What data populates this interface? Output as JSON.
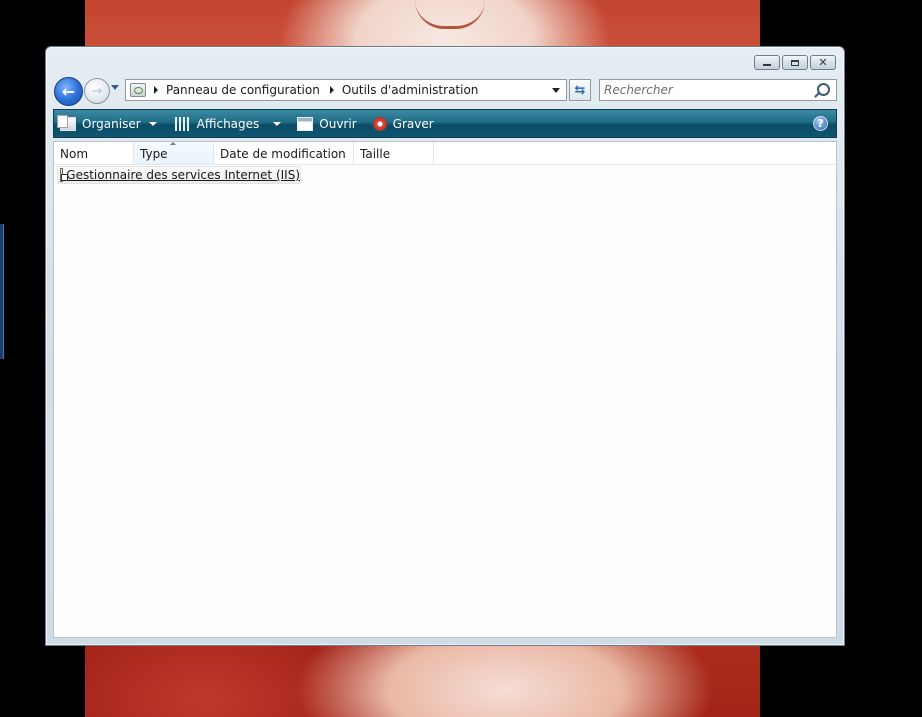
{
  "window": {
    "controls": {
      "minimize": "minimize",
      "maximize": "maximize",
      "close": "close"
    }
  },
  "nav": {
    "back_icon": "back-arrow-icon",
    "forward_icon": "forward-arrow-icon",
    "breadcrumbs": [
      "Panneau de configuration",
      "Outils d'administration"
    ],
    "search_placeholder": "Rechercher"
  },
  "toolbar": {
    "organize_label": "Organiser",
    "views_label": "Affichages",
    "open_label": "Ouvrir",
    "burn_label": "Graver",
    "help_glyph": "?"
  },
  "columns": [
    {
      "label": "Nom"
    },
    {
      "label": "Type",
      "sorted": true
    },
    {
      "label": "Date de modification"
    },
    {
      "label": "Taille"
    }
  ],
  "files": [
    {
      "name": "Gestionnaire des services Internet (IIS)",
      "icon": "shortcut-icon"
    }
  ],
  "colors": {
    "command_bar": "#1f6c86",
    "accent_blue": "#2a6fd6"
  }
}
